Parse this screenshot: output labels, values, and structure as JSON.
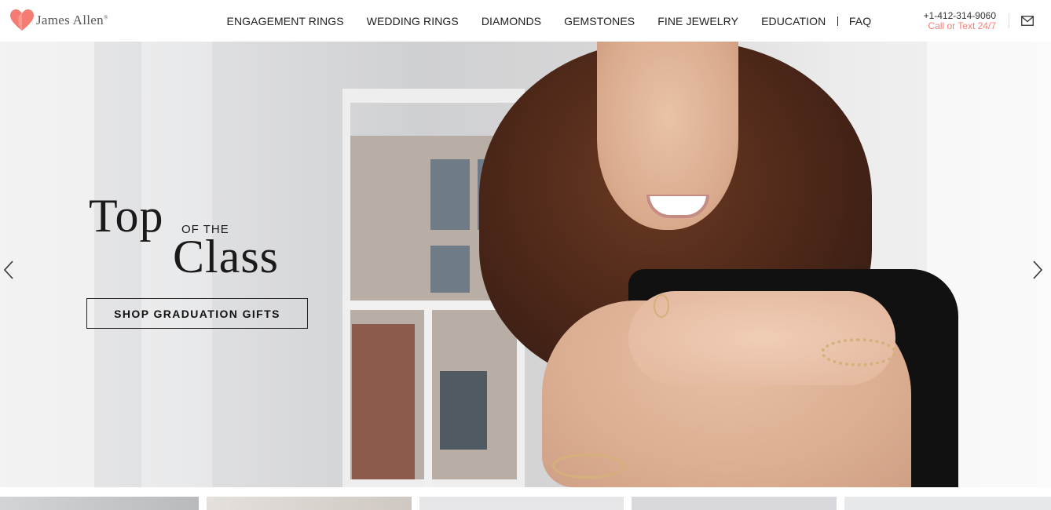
{
  "brand": {
    "name": "James Allen",
    "registered": "®",
    "heart_color": "#f47c73"
  },
  "nav": {
    "items": [
      {
        "label": "ENGAGEMENT RINGS"
      },
      {
        "label": "WEDDING RINGS"
      },
      {
        "label": "DIAMONDS"
      },
      {
        "label": "GEMSTONES"
      },
      {
        "label": "FINE JEWELRY"
      },
      {
        "label": "EDUCATION"
      }
    ],
    "faq": "FAQ"
  },
  "contact": {
    "phone": "+1-412-314-9060",
    "call_text": "Call or Text 24/7",
    "accent": "#f37f77"
  },
  "icons": {
    "mail": "mail-icon",
    "prev": "chevron-left-icon",
    "next": "chevron-right-icon"
  },
  "hero": {
    "title_top": "Top",
    "title_of_the": "OF THE",
    "title_class": "Class",
    "cta": "SHOP GRADUATION GIFTS"
  }
}
